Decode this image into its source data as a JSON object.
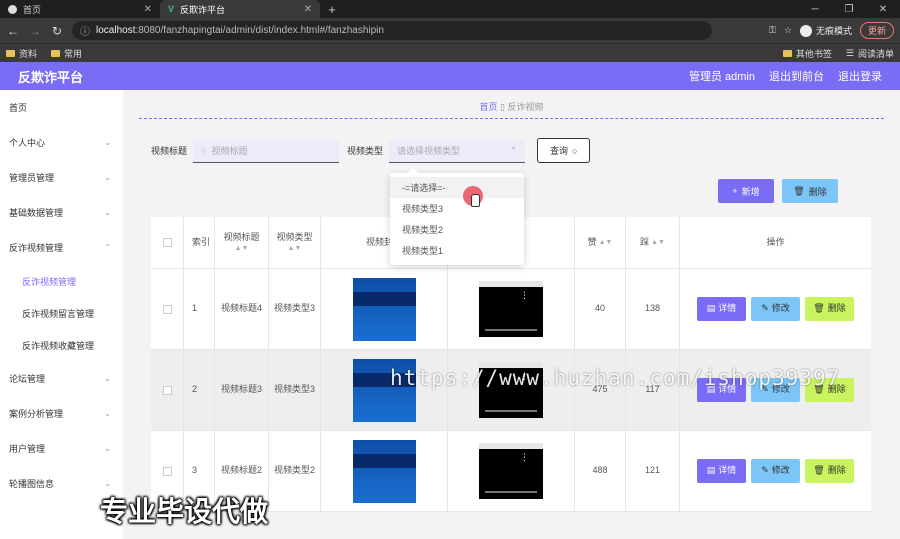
{
  "browser": {
    "tabs": [
      {
        "title": "首页",
        "active": false
      },
      {
        "title": "反欺诈平台",
        "active": true
      }
    ],
    "url_host": "localhost",
    "url_rest": ":8080/fanzhapingtai/admin/dist/index.html#/fanzhashipin",
    "incognito_label": "无痕模式",
    "update_label": "更新",
    "bookmarks": [
      "资料",
      "常用"
    ],
    "bookmarks_right": [
      "其他书签",
      "阅读清单"
    ]
  },
  "header": {
    "logo": "反欺诈平台",
    "user": "管理员 admin",
    "back_front": "退出到前台",
    "logout": "退出登录"
  },
  "sidebar": {
    "items": [
      {
        "label": "首页",
        "chevron": false
      },
      {
        "label": "个人中心",
        "chevron": true
      },
      {
        "label": "管理员管理",
        "chevron": true
      },
      {
        "label": "基础数据管理",
        "chevron": true
      },
      {
        "label": "反诈视频管理",
        "chevron": true
      }
    ],
    "subitems": [
      "反诈视频管理",
      "反诈视频留言管理",
      "反诈视频收藏管理"
    ],
    "items_after": [
      {
        "label": "论坛管理"
      },
      {
        "label": "案例分析管理"
      },
      {
        "label": "用户管理"
      },
      {
        "label": "轮播图信息"
      }
    ]
  },
  "breadcrumb": {
    "home": "首页",
    "current": "反诈视频"
  },
  "search": {
    "title_label": "视频标题",
    "title_placeholder": "视频标题",
    "type_label": "视频类型",
    "type_placeholder": "请选择视频类型",
    "query_button": "查询"
  },
  "actions": {
    "add": "新增",
    "delete": "删除"
  },
  "dropdown": {
    "options": [
      "-=请选择=-",
      "视频类型3",
      "视频类型2",
      "视频类型1"
    ]
  },
  "table": {
    "headers": {
      "index": "索引",
      "title": "视频标题",
      "type": "视频类型",
      "cover": "视频封面",
      "likes": "赞",
      "dislikes": "踩",
      "ops": "操作"
    },
    "rows": [
      {
        "index": "1",
        "title": "视频标题4",
        "type": "视频类型3",
        "likes": "40",
        "dislikes": "138"
      },
      {
        "index": "2",
        "title": "视频标题3",
        "type": "视频类型3",
        "likes": "475",
        "dislikes": "117"
      },
      {
        "index": "3",
        "title": "视频标题2",
        "type": "视频类型2",
        "likes": "488",
        "dislikes": "121"
      }
    ],
    "op_labels": {
      "detail": "详情",
      "edit": "修改",
      "remove": "删除"
    }
  },
  "overlay": {
    "watermark": "https://www.huzhan.com/ishop39397",
    "promo": "专业毕设代做"
  },
  "colors": {
    "accent": "#7b6cf6",
    "light_blue": "#7cc6f7",
    "lime": "#c9f35f"
  }
}
